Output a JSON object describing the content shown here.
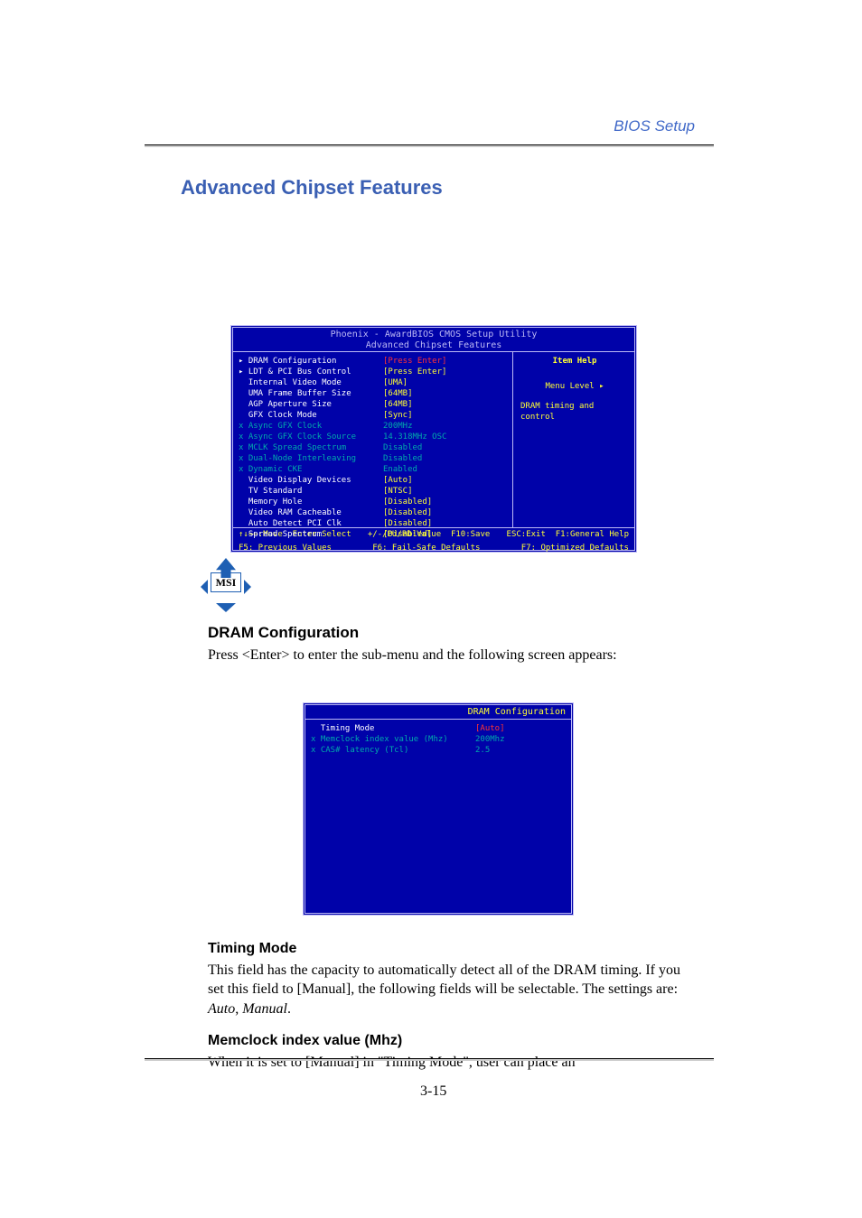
{
  "doc": {
    "header_right": "BIOS Setup",
    "section_title": "Advanced Chipset Features",
    "msi_label": "MSI",
    "page_number": "3-15"
  },
  "bios1": {
    "title_line1": "Phoenix - AwardBIOS CMOS Setup Utility",
    "title_line2": "Advanced Chipset Features",
    "rows": [
      {
        "label": "▸ DRAM Configuration",
        "value": "[Press Enter]"
      },
      {
        "label": "▸ LDT & PCI Bus Control",
        "value": "[Press Enter]"
      },
      {
        "label": "  Internal Video Mode",
        "value": "[UMA]"
      },
      {
        "label": "  UMA Frame Buffer Size",
        "value": "[64MB]"
      },
      {
        "label": "  AGP Aperture Size",
        "value": "[64MB]"
      },
      {
        "label": "  GFX Clock Mode",
        "value": "[Sync]"
      },
      {
        "label": "x Async GFX Clock",
        "value": "200MHz"
      },
      {
        "label": "x Async GFX Clock Source",
        "value": "14.318MHz OSC"
      },
      {
        "label": "x MCLK Spread Spectrum",
        "value": "Disabled"
      },
      {
        "label": "x Dual-Node Interleaving",
        "value": "Disabled"
      },
      {
        "label": "x Dynamic CKE",
        "value": "Enabled"
      },
      {
        "label": "  Video Display Devices",
        "value": "[Auto]"
      },
      {
        "label": "  TV Standard",
        "value": "[NTSC]"
      },
      {
        "label": "  Memory Hole",
        "value": "[Disabled]"
      },
      {
        "label": "  Video RAM Cacheable",
        "value": "[Disabled]"
      },
      {
        "label": "  Auto Detect PCI Clk",
        "value": "[Disabled]"
      },
      {
        "label": "  Spread Spectrum",
        "value": "[Disabled]"
      }
    ],
    "help": {
      "title": "Item Help",
      "menu_level": "Menu Level",
      "desc": "DRAM timing and control"
    },
    "footer": {
      "l1a": "↑↓→←:Move  Enter:Select",
      "l1b": "+/-/PU/PD:Value  F10:Save",
      "l1c": "ESC:Exit  F1:General Help",
      "l2a": "F5: Previous Values",
      "l2b": "F6: Fail-Safe Defaults",
      "l2c": "F7: Optimized Defaults"
    }
  },
  "prose1": {
    "heading": "DRAM Configuration",
    "body": "Press <Enter> to enter the sub-menu and the following screen appears:"
  },
  "bios2": {
    "title": "DRAM Configuration",
    "rows": [
      {
        "label": "  Timing Mode",
        "value": "[Auto]"
      },
      {
        "label": "x Memclock index value (Mhz)",
        "value": "200Mhz"
      },
      {
        "label": "x CAS# latency (Tcl)",
        "value": "2.5"
      }
    ]
  },
  "prose2": {
    "heading": "Timing Mode",
    "body": "This field has the capacity to automatically detect all of the DRAM timing. If you set this field to [Manual], the following fields will be selectable. The settings are: ",
    "auto": "Auto",
    "sep1": ", ",
    "manual": "Manual",
    "period": "."
  },
  "prose3": {
    "heading": "Memclock index value (Mhz)",
    "body": "When it is set to [Manual] in \"Timing Mode\", user can place an"
  }
}
